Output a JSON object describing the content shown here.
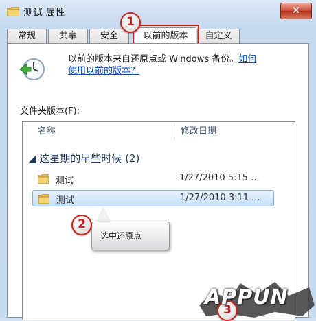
{
  "window": {
    "title": "测试 属性",
    "close_label": "✕"
  },
  "tabs": [
    {
      "label": "常规"
    },
    {
      "label": "共享"
    },
    {
      "label": "安全"
    },
    {
      "label": "以前的版本"
    },
    {
      "label": "自定义"
    }
  ],
  "description": {
    "text": "以前的版本来自还原点或 Windows 备份。",
    "link_line1": "如何",
    "link_line2": "使用以前的版本？"
  },
  "folder_versions_label": "文件夹版本(F):",
  "list": {
    "columns": [
      "名称",
      "修改日期"
    ],
    "group_label": "◢ 这星期的早些时候 (2)",
    "rows": [
      {
        "name": "测试",
        "date": "1/27/2010 5:15 ..."
      },
      {
        "name": "测试",
        "date": "1/27/2010 3:11 ..."
      }
    ]
  },
  "annotations": {
    "badge1": "1",
    "badge2": "2",
    "badge3": "3",
    "callout": "选中还原点"
  },
  "watermark": "APPUN",
  "colors": {
    "highlight_red": "#c8201e",
    "link_blue": "#0645ad",
    "selection_blue": "#c4e0fc"
  },
  "icons": [
    "folder-icon",
    "restore-clock-icon",
    "close-icon"
  ]
}
